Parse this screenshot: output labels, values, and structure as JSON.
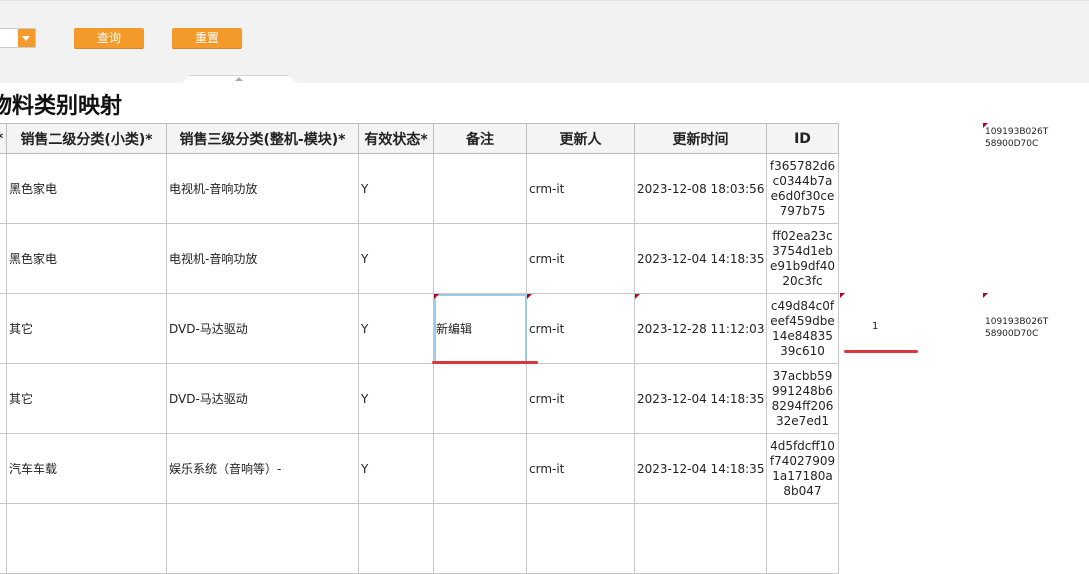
{
  "toolbar": {
    "query_label": "查询",
    "reset_label": "重置"
  },
  "title": "物料类别映射",
  "table": {
    "headers": [
      "*",
      "销售二级分类(小类)*",
      "销售三级分类(整机-模块)*",
      "有效状态*",
      "备注",
      "更新人",
      "更新时间",
      "ID"
    ],
    "rows": [
      {
        "cat2": "黑色家电",
        "cat3": "电视机-音响功放",
        "status": "Y",
        "remark": "",
        "updater": "crm-it",
        "time": "2023-12-08 18:03:56",
        "id": "f365782d6c0344b7ae6d0f30ce797b75"
      },
      {
        "cat2": "黑色家电",
        "cat3": "电视机-音响功放",
        "status": "Y",
        "remark": "",
        "updater": "crm-it",
        "time": "2023-12-04 14:18:35",
        "id": "ff02ea23c3754d1ebe91b9df4020c3fc"
      },
      {
        "cat2": "其它",
        "cat3": "DVD-马达驱动",
        "status": "Y",
        "remark": "新编辑",
        "updater": "crm-it",
        "time": "2023-12-28 11:12:03",
        "id": "c49d84c0feef459dbe14e8483539c610"
      },
      {
        "cat2": "其它",
        "cat3": "DVD-马达驱动",
        "status": "Y",
        "remark": "",
        "updater": "crm-it",
        "time": "2023-12-04 14:18:35",
        "id": "37acbb59991248b68294ff20632e7ed1"
      },
      {
        "cat2": "汽车车载",
        "cat3": "娱乐系统（音响等）-",
        "status": "Y",
        "remark": "",
        "updater": "crm-it",
        "time": "2023-12-04 14:18:35",
        "id": "4d5fdcff10f740279091a17180a8b047"
      }
    ]
  },
  "side": {
    "code_line1": "109193B026T",
    "code_line2": "58900D70C",
    "edit_count": "1"
  },
  "colors": {
    "accent": "#f39a2b",
    "highlight_line": "#d9363e",
    "dirty_marker": "#b00020"
  }
}
